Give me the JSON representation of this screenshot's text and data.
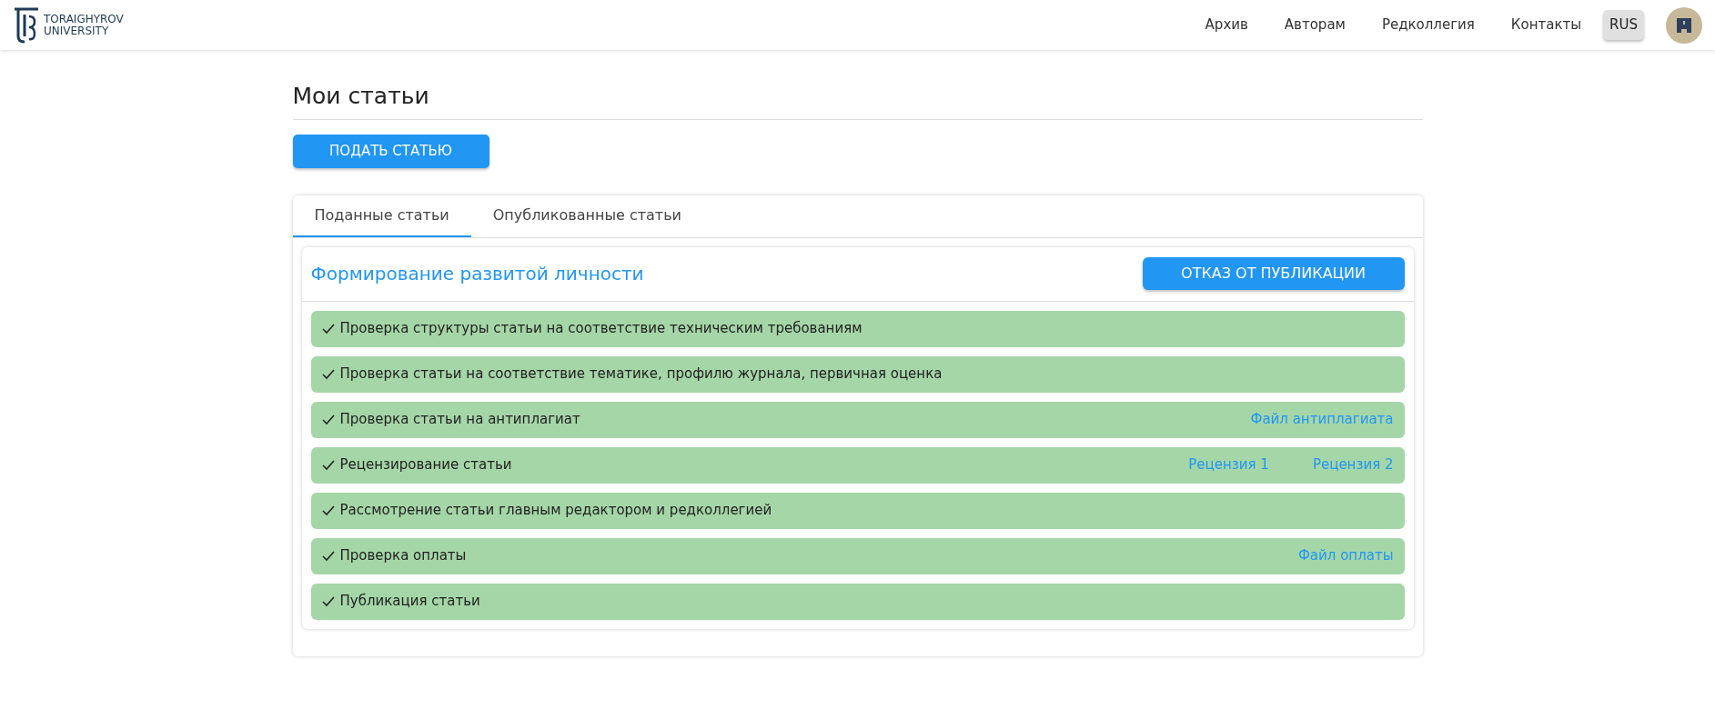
{
  "header": {
    "logo_text": [
      "TORAIGHYROV",
      "UNIVERSITY"
    ],
    "nav": [
      "Архив",
      "Авторам",
      "Редколлегия",
      "Контакты"
    ],
    "language": "RUS"
  },
  "page_title": "Мои статьи",
  "submit_button": "ПОДАТЬ СТАТЬЮ",
  "tabs": [
    {
      "label": "Поданные статьи",
      "selected": true
    },
    {
      "label": "Опубликованные статьи",
      "selected": false
    }
  ],
  "article": {
    "title": "Формирование развитой личности",
    "withdraw_button": "ОТКАЗ ОТ ПУБЛИКАЦИИ",
    "steps": [
      {
        "label": "Проверка структуры статьи на соответствие техническим требованиям",
        "done": true
      },
      {
        "label": "Проверка статьи на соответствие тематике, профилю журнала, первичная оценка",
        "done": true
      },
      {
        "label": "Проверка статьи на антиплагиат",
        "done": true,
        "links": [
          "Файл антиплагиата"
        ]
      },
      {
        "label": "Рецензирование статьи",
        "done": true,
        "links": [
          "Рецензия 1",
          "Рецензия 2"
        ]
      },
      {
        "label": "Рассмотрение статьи главным редактором и редколлегией",
        "done": true
      },
      {
        "label": "Проверка оплаты",
        "done": true,
        "links": [
          "Файл оплаты"
        ]
      },
      {
        "label": "Публикация статьи",
        "done": true
      }
    ]
  }
}
